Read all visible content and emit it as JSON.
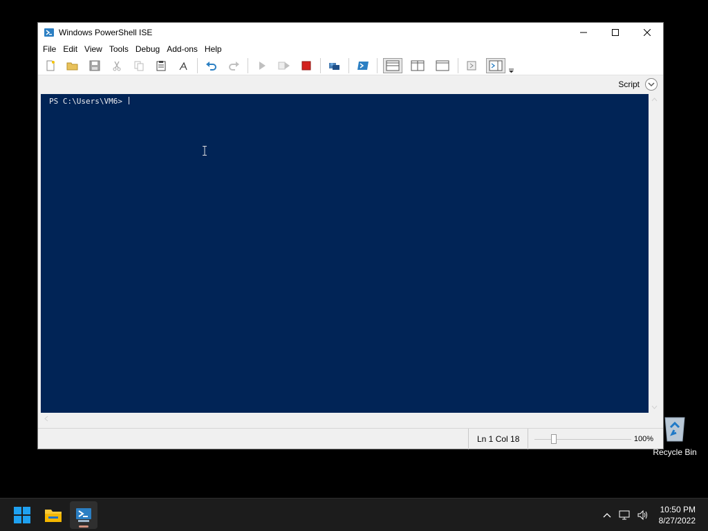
{
  "window": {
    "title": "Windows PowerShell ISE",
    "menus": [
      "File",
      "Edit",
      "View",
      "Tools",
      "Debug",
      "Add-ons",
      "Help"
    ],
    "script_pane_label": "Script",
    "console_prompt": "PS C:\\Users\\VM6> ",
    "status": {
      "position": "Ln 1  Col 18",
      "zoom": "100%",
      "zoom_level_percent": 100
    }
  },
  "desktop": {
    "recycle_bin_label": "Recycle Bin"
  },
  "taskbar": {
    "time": "10:50 PM",
    "date": "8/27/2022"
  },
  "colors": {
    "console_background": "#012456",
    "console_text": "#eeedf0",
    "accent": "#0078d4"
  }
}
